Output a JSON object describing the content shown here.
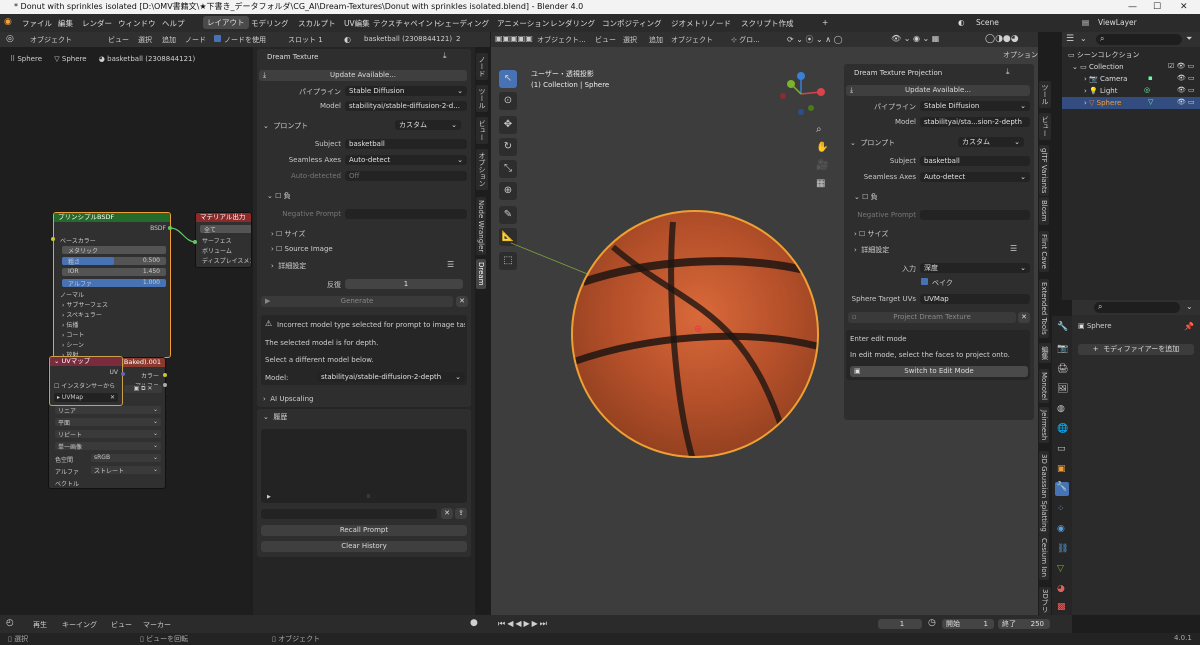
{
  "window": {
    "title": "* Donut with sprinkles isolated [D:\\OMV書籍文\\★下書き_データフォルダ\\CG_AI\\Dream-Textures\\Donut with sprinkles isolated.blend] - Blender 4.0",
    "min": "—",
    "max": "☐",
    "close": "✕"
  },
  "menu": {
    "items": [
      "ファイル",
      "編集",
      "レンダー",
      "ウィンドウ",
      "ヘルプ"
    ],
    "workspaces": [
      "レイアウト",
      "モデリング",
      "スカルプト",
      "UV編集",
      "テクスチャペイント",
      "シェーディング",
      "アニメーション",
      "レンダリング",
      "コンポジティング",
      "ジオメトリノード",
      "スクリプト作成"
    ],
    "add": "+",
    "scene": "Scene",
    "viewlayer": "ViewLayer"
  },
  "node_editor": {
    "header": {
      "mode": "オブジェクト",
      "view": "ビュー",
      "select": "選択",
      "add": "追加",
      "node": "ノード",
      "use_nodes": "ノードを使用",
      "slot": "スロット 1",
      "material": "basketball (2308844121)",
      "users": "2"
    },
    "breadcrumb": [
      "Sphere",
      "Sphere",
      "basketball (2308844121)"
    ],
    "bsdf": {
      "title": "プリンシプルBSDF",
      "out": "BSDF",
      "rows": [
        "ベースカラー",
        "メタリック",
        "粗さ",
        "IOR",
        "アルファ",
        "ノーマル",
        "サブサーフェス",
        "スペキュラー",
        "伝播",
        "コート",
        "シーン",
        "放射"
      ],
      "metallic": "",
      "rough": "0.500",
      "ior": "1.450",
      "alpha": "1.000"
    },
    "output": {
      "title": "マテリアル出力",
      "rows": [
        "全て",
        "サーフェス",
        "ボリューム",
        "ディスプレイスメント"
      ]
    },
    "uvmap": {
      "title": "UVマップ",
      "instancer": "インスタンサーから",
      "uv": "UVMap",
      "out": "UV"
    },
    "image": {
      "title": "1) (Baked).001",
      "rows": [
        "カラー",
        "アルファ"
      ],
      "interp": "リニア",
      "proj": "平面",
      "ext": "リピート",
      "single": "単一画像",
      "colorspace_label": "色空間",
      "colorspace": "sRGB",
      "alpha_label": "アルファ",
      "alpha": "ストレート",
      "vector": "ベクトル"
    }
  },
  "dream": {
    "title": "Dream Texture",
    "update": "Update Available...",
    "pipeline_label": "パイプライン",
    "pipeline": "Stable Diffusion",
    "model_label": "Model",
    "model": "stabilityai/stable-diffusion-2-d...",
    "prompt": "プロンプト",
    "prompt_mode": "カスタム",
    "subject_label": "Subject",
    "subject": "basketball",
    "seamless_label": "Seamless Axes",
    "seamless": "Auto-detect",
    "autodet_label": "Auto-detected",
    "autodet": "Off",
    "negative": "負",
    "neg_prompt_label": "Negative Prompt",
    "size": "サイズ",
    "source": "Source Image",
    "advanced": "詳細設定",
    "iter_label": "反復",
    "iter": "1",
    "generate": "Generate",
    "err1": "Incorrect model type selected for prompt to image tas...",
    "err2": "The selected model is for depth.",
    "err3": "Select a different model below.",
    "model2_label": "Model:",
    "model2": "stabilityai/stable-diffusion-2-depth",
    "upscaling": "AI Upscaling",
    "history": "履歴",
    "recall": "Recall Prompt",
    "clear": "Clear History"
  },
  "side_tabs": [
    "ノード",
    "ツール",
    "ビュー",
    "オプション",
    "Node Wrangler",
    "Dream"
  ],
  "viewport": {
    "mode": "オブジェクト...",
    "view": "ビュー",
    "select": "選択",
    "add": "追加",
    "object": "オブジェクト",
    "global": "グロ...",
    "options": "オプション",
    "title": "ユーザー・透視投影",
    "subtitle": "(1) Collection | Sphere"
  },
  "projection": {
    "title": "Dream Texture Projection",
    "update": "Update Available...",
    "pipeline_label": "パイプライン",
    "pipeline": "Stable Diffusion",
    "model_label": "Model",
    "model": "stabilityai/sta...sion-2-depth",
    "prompt": "プロンプト",
    "prompt_mode": "カスタム",
    "subject_label": "Subject",
    "subject": "basketball",
    "seamless_label": "Seamless Axes",
    "seamless": "Auto-detect",
    "negative": "負",
    "neg_prompt_label": "Negative Prompt",
    "size": "サイズ",
    "advanced": "詳細設定",
    "input_label": "入力",
    "input": "深度",
    "bake": "ベイク",
    "uv_label": "Sphere Target UVs",
    "uv": "UVMap",
    "project": "Project Dream Texture",
    "edit_title": "Enter edit mode",
    "edit_msg": "In edit mode, select the faces to project onto.",
    "switch": "Switch to Edit Mode"
  },
  "vp_tabs": [
    "ツール",
    "ビュー",
    "glTF Variants",
    "Blosm",
    "Flint Cave",
    "Extended Tools",
    "編集",
    "Monotel",
    "Jeirmesh",
    "3D Gaussian Splatting",
    "Cesium Ion",
    "3Dプリ"
  ],
  "outliner": {
    "search": "",
    "items": [
      {
        "name": "シーンコレクション"
      },
      {
        "name": "Collection"
      },
      {
        "name": "Camera"
      },
      {
        "name": "Light"
      },
      {
        "name": "Sphere"
      }
    ]
  },
  "properties": {
    "object": "Sphere",
    "add_modifier": "モディファイアーを追加"
  },
  "timeline": {
    "play": "再生",
    "keying": "キーイング",
    "view": "ビュー",
    "marker": "マーカー",
    "frame": "1",
    "start_label": "開始",
    "start": "1",
    "end_label": "終了",
    "end": "250"
  },
  "status": {
    "select": "選択",
    "rotate": "ビューを回転",
    "object": "オブジェクト",
    "version": "4.0.1"
  }
}
